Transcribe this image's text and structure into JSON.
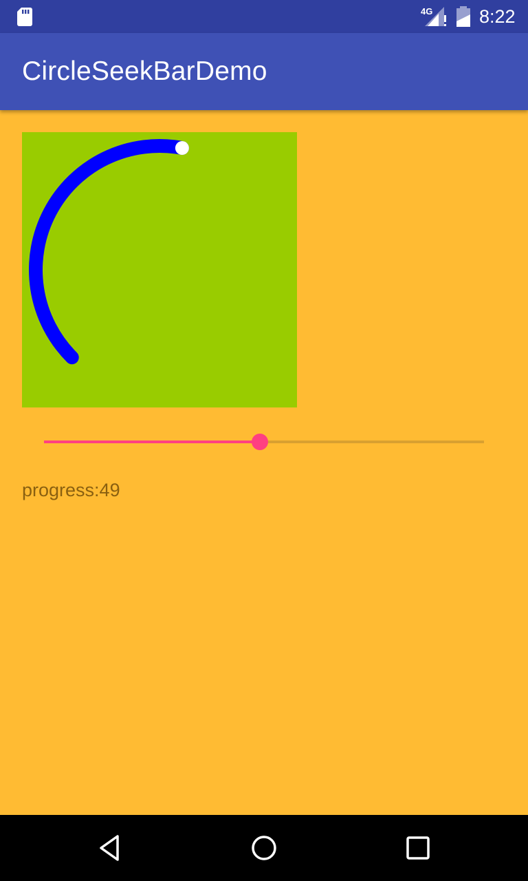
{
  "status_bar": {
    "time": "8:22",
    "network": "4G",
    "icons": [
      "sd-card-icon",
      "signal-icon",
      "battery-icon"
    ]
  },
  "app": {
    "title": "CircleSeekBarDemo",
    "primary_color": "#3F51B5",
    "primary_dark": "#303F9F",
    "background_color": "#FFBB33"
  },
  "circle_seekbar": {
    "background_color": "#99CC00",
    "progress_color": "#0000FF",
    "thumb_color": "#FFFFFF",
    "progress": 49
  },
  "seekbar": {
    "progress": 49,
    "max": 100,
    "accent_color": "#FF4081"
  },
  "progress_label": "progress:49",
  "nav_bar": {
    "buttons": [
      "back-icon",
      "home-icon",
      "recents-icon"
    ]
  }
}
